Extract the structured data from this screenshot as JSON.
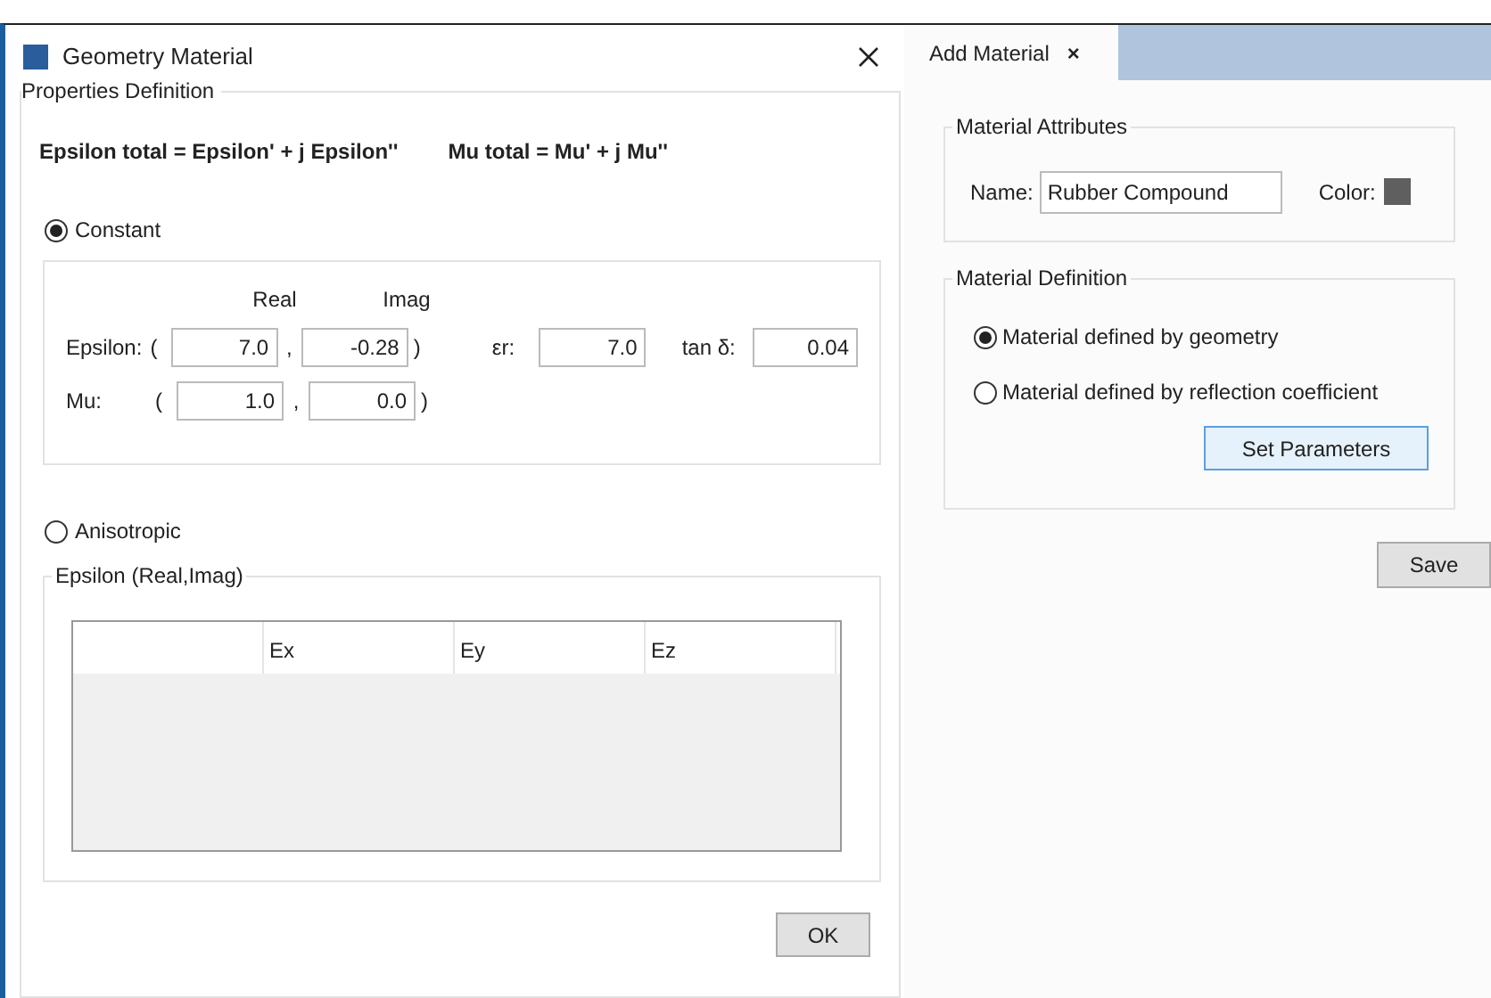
{
  "dialog": {
    "title": "Geometry Material",
    "group_title": "Properties Definition",
    "formula_epsilon": "Epsilon total = Epsilon' + j Epsilon''",
    "formula_mu": "Mu total = Mu' + j Mu''",
    "modes": [
      {
        "label": "Constant",
        "selected": true
      },
      {
        "label": "Anisotropic",
        "selected": false
      }
    ],
    "constant": {
      "headers": [
        "Real",
        "Imag"
      ],
      "rows": [
        {
          "label": "Epsilon:",
          "open": "(",
          "real": "7.0",
          "comma": ",",
          "imag": "-0.28",
          "close": ")"
        },
        {
          "label": "Mu:",
          "open": "(",
          "real": "1.0",
          "comma": ",",
          "imag": "0.0",
          "close": ")"
        }
      ],
      "er_label": "εr:",
      "er_value": "7.0",
      "tan_label": "tan δ:",
      "tan_value": "0.04"
    },
    "anisotropic": {
      "group_title": "Epsilon (Real,Imag)",
      "columns": [
        "Ex",
        "Ey",
        "Ez"
      ]
    },
    "ok_button": "OK"
  },
  "panel": {
    "tab": {
      "label": "Add Material",
      "close": "×",
      "selected": true
    },
    "attributes": {
      "group_title": "Material Attributes",
      "name_label": "Name:",
      "name_value": "Rubber Compound",
      "color_label": "Color:",
      "color": "#5f5f5f"
    },
    "definition": {
      "group_title": "Material Definition",
      "options": [
        {
          "label": "Material defined by geometry",
          "selected": true
        },
        {
          "label": "Material defined by reflection coefficient",
          "selected": false
        }
      ],
      "button": "Set Parameters"
    },
    "save_button": "Save"
  }
}
